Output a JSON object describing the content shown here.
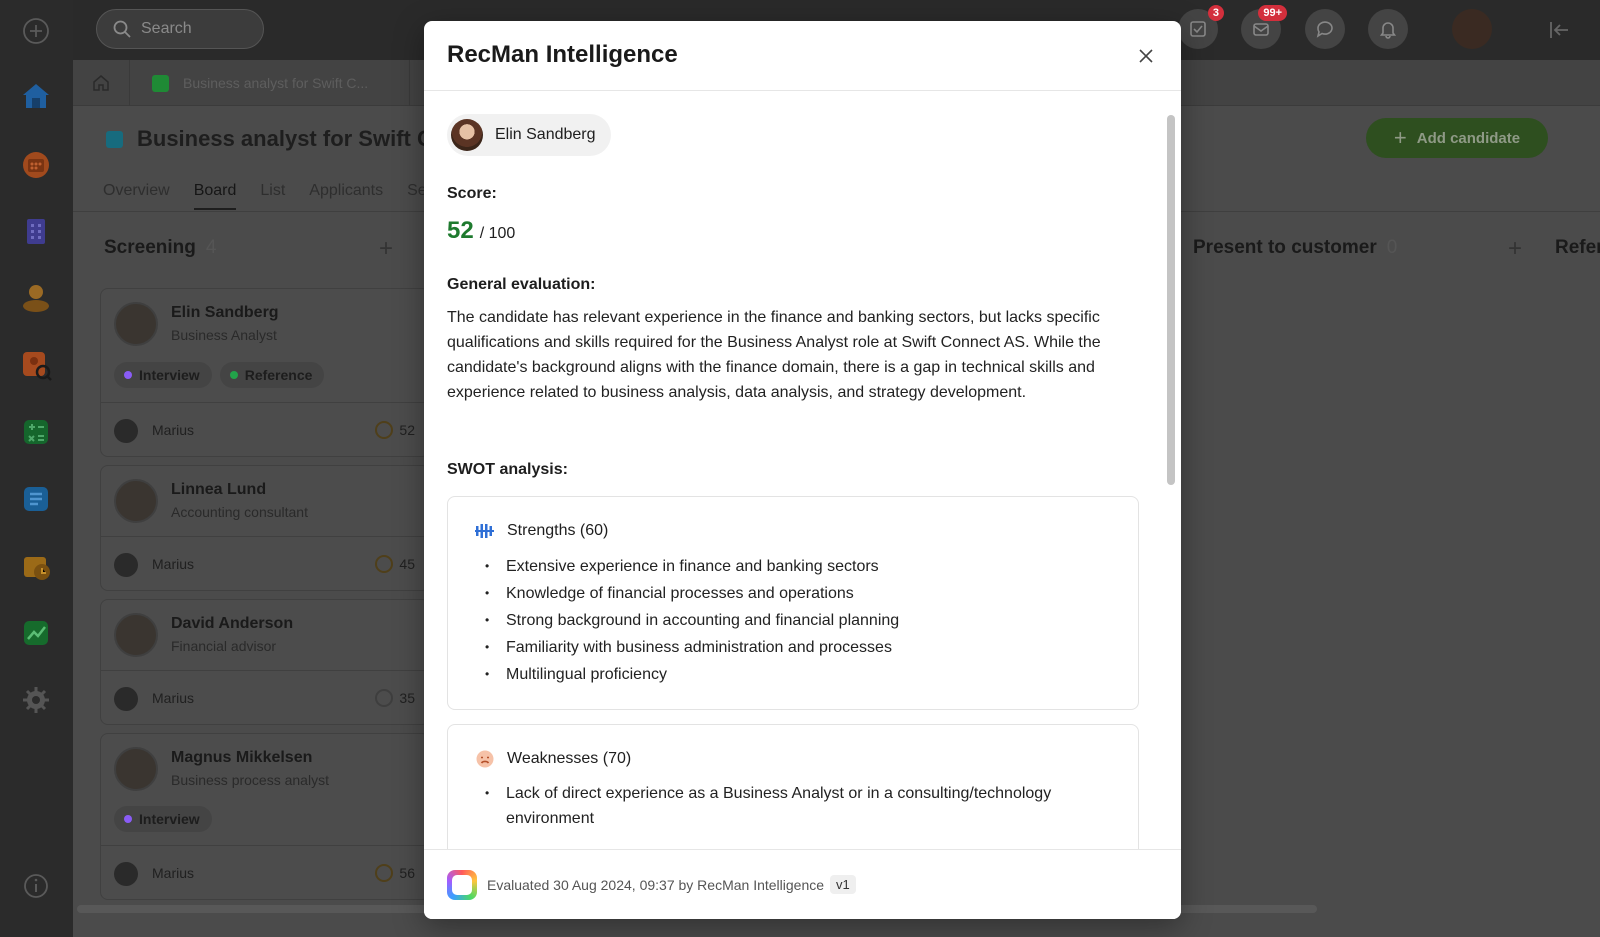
{
  "topbar": {
    "search_placeholder": "Search",
    "tasks_badge": "3",
    "mail_badge": "99+"
  },
  "tabs": {
    "doc_tab_label": "Business analyst for Swift C..."
  },
  "page": {
    "title": "Business analyst for Swift Co",
    "subtabs": [
      "Overview",
      "Board",
      "List",
      "Applicants",
      "Se"
    ],
    "add_candidate": "Add candidate"
  },
  "board": {
    "screening": {
      "title": "Screening",
      "count": "4"
    },
    "present": {
      "title": "Present to customer",
      "count": "0"
    },
    "refer": {
      "title": "Refer"
    },
    "cards": [
      {
        "name": "Elin Sandberg",
        "role": "Business Analyst",
        "tags": [
          "Interview",
          "Reference"
        ],
        "owner": "Marius",
        "score": "52"
      },
      {
        "name": "Linnea Lund",
        "role": "Accounting consultant",
        "tags": [],
        "owner": "Marius",
        "score": "45"
      },
      {
        "name": "David Anderson",
        "role": "Financial advisor",
        "tags": [],
        "owner": "Marius",
        "score": "35"
      },
      {
        "name": "Magnus Mikkelsen",
        "role": "Business process analyst",
        "tags": [
          "Interview"
        ],
        "owner": "Marius",
        "score": "56"
      }
    ]
  },
  "modal": {
    "title": "RecMan Intelligence",
    "candidate": "Elin Sandberg",
    "score_label": "Score:",
    "score_value": "52",
    "score_max": "/ 100",
    "evaluation_label": "General evaluation:",
    "evaluation_text": "The candidate has relevant experience in the finance and banking sectors, but lacks specific qualifications and skills required for the Business Analyst role at Swift Connect AS. While the candidate's background aligns with the finance domain, there is a gap in technical skills and experience related to business analysis, data analysis, and strategy development.",
    "swot_label": "SWOT analysis:",
    "strengths": {
      "title": "Strengths (60)",
      "items": [
        "Extensive experience in finance and banking sectors",
        "Knowledge of financial processes and operations",
        "Strong background in accounting and financial planning",
        "Familiarity with business administration and processes",
        "Multilingual proficiency"
      ]
    },
    "weaknesses": {
      "title": "Weaknesses (70)",
      "items": [
        "Lack of direct experience as a Business Analyst or in a consulting/technology environment"
      ]
    },
    "footer": {
      "evaluated": "Evaluated 30 Aug 2024, 09:37 by RecMan Intelligence",
      "version": "v1"
    }
  },
  "colors": {
    "accent_green": "#1e7a2e",
    "badge_red": "#d32f3c",
    "interview_purple": "#8a5cf6",
    "reference_green": "#22a34a"
  }
}
